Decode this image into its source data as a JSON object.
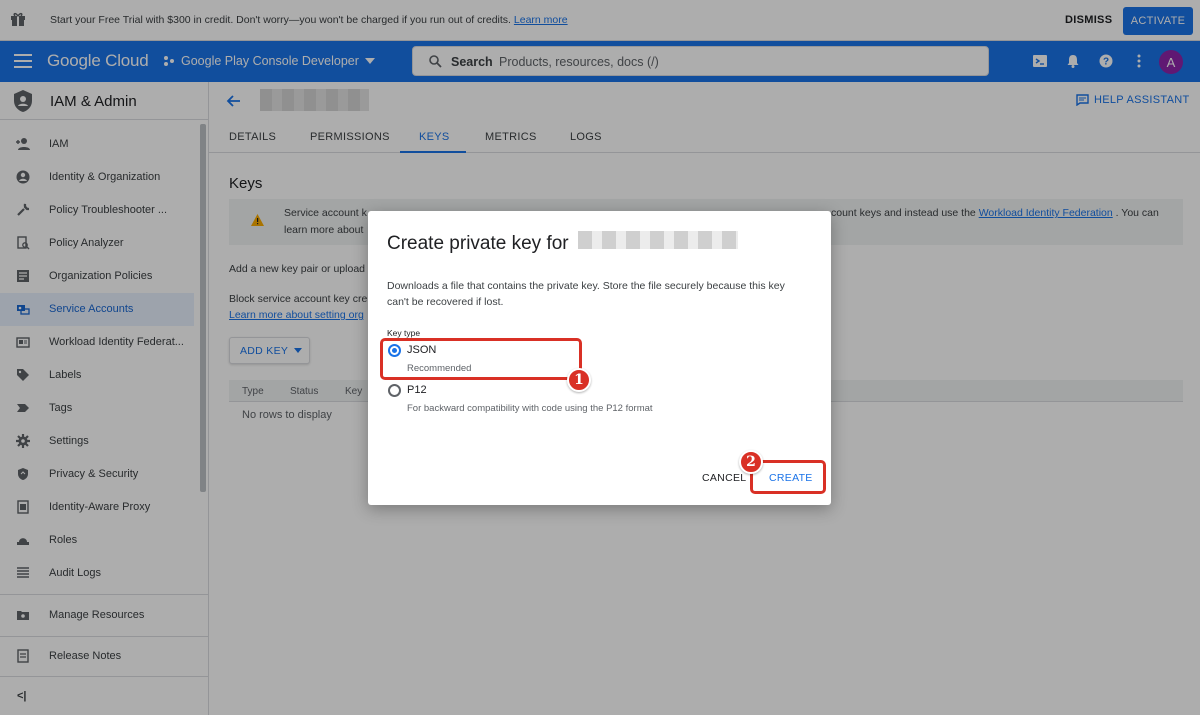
{
  "banner": {
    "message": "Start your Free Trial with $300 in credit. Don't worry—you won't be charged if you run out of credits.",
    "learn_more": "Learn more",
    "dismiss": "DISMISS",
    "activate": "ACTIVATE"
  },
  "topbar": {
    "logo": "Google Cloud",
    "project": "Google Play Console Developer",
    "search_label": "Search",
    "search_placeholder": "Products, resources, docs (/)",
    "avatar": "A"
  },
  "sidebar": {
    "title": "IAM & Admin",
    "items": [
      {
        "label": "IAM",
        "icon": "person-add-icon"
      },
      {
        "label": "Identity & Organization",
        "icon": "account-circle-icon"
      },
      {
        "label": "Policy Troubleshooter ...",
        "icon": "wrench-icon"
      },
      {
        "label": "Policy Analyzer",
        "icon": "document-search-icon"
      },
      {
        "label": "Organization Policies",
        "icon": "list-doc-icon"
      },
      {
        "label": "Service Accounts",
        "icon": "service-account-icon"
      },
      {
        "label": "Workload Identity Federat...",
        "icon": "id-card-icon"
      },
      {
        "label": "Labels",
        "icon": "label-icon"
      },
      {
        "label": "Tags",
        "icon": "tag-arrow-icon"
      },
      {
        "label": "Settings",
        "icon": "gear-icon"
      },
      {
        "label": "Privacy & Security",
        "icon": "shield-icon"
      },
      {
        "label": "Identity-Aware Proxy",
        "icon": "proxy-icon"
      },
      {
        "label": "Roles",
        "icon": "hat-icon"
      },
      {
        "label": "Audit Logs",
        "icon": "lines-icon"
      }
    ],
    "manage_resources": "Manage Resources",
    "release_notes": "Release Notes",
    "collapse": "<|"
  },
  "main": {
    "help_assistant": "HELP ASSISTANT",
    "tabs": [
      "DETAILS",
      "PERMISSIONS",
      "KEYS",
      "METRICS",
      "LOGS"
    ],
    "keys_heading": "Keys",
    "notice_line1": "Service account k",
    "notice_line2": "learn more about",
    "notice_right": "count keys and instead use the",
    "notice_link": "Workload Identity Federation",
    "notice_tail": ". You can",
    "add_pair": "Add a new key pair or upload",
    "block_text": "Block service account key cre",
    "learn_setting": "Learn more about setting org",
    "add_key": "ADD KEY",
    "table_headers": [
      "Type",
      "Status",
      "Key"
    ],
    "no_rows": "No rows to display"
  },
  "dialog": {
    "title": "Create private key for",
    "desc_line1": "Downloads a file that contains the private key. Store the file securely because this key",
    "desc_line2": "can't be recovered if lost.",
    "key_type_label": "Key type",
    "options": [
      {
        "label": "JSON",
        "sub": "Recommended",
        "selected": true
      },
      {
        "label": "P12",
        "sub": "For backward compatibility with code using the P12 format",
        "selected": false
      }
    ],
    "cancel": "CANCEL",
    "create": "CREATE"
  },
  "annotations": {
    "badge1": "1",
    "badge2": "2",
    "color": "#d93025"
  }
}
